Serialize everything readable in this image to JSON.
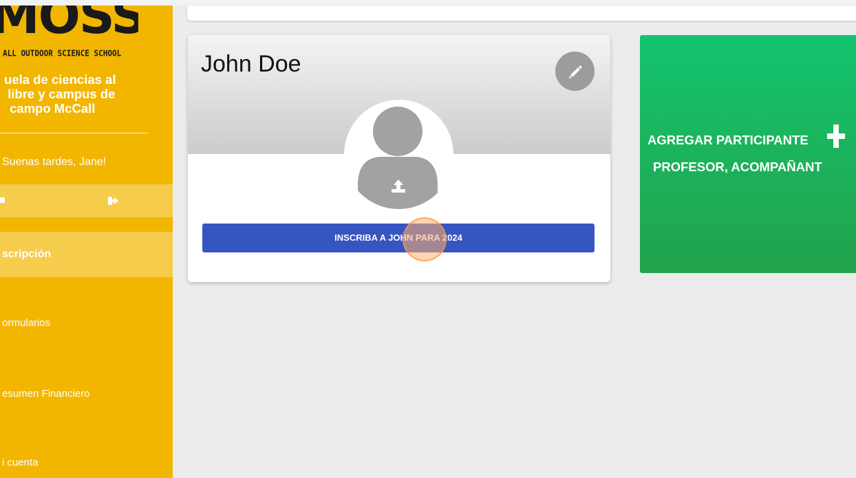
{
  "sidebar": {
    "logo_text": "MOSS",
    "logo_subtitle": "ALL OUTDOOR SCIENCE SCHOOL",
    "school_name": "uela de ciencias al libre y campus de campo McCall",
    "school_name_lines": [
      "uela de ciencias al",
      " libre y campus de",
      "campo McCall"
    ],
    "greeting": "Suenas tardes, Jane!",
    "nav_items": [
      {
        "label": "scripción",
        "active": true
      },
      {
        "label": "ormularios",
        "active": false
      },
      {
        "label": "esumen Financiero",
        "active": false
      },
      {
        "label": "i cuenta",
        "active": false
      }
    ]
  },
  "profile": {
    "name": "John Doe",
    "register_button": "INSCRIBA A JOHN PARA 2024"
  },
  "add_card": {
    "line1": "AGREGAR PARTICIPANTE",
    "line2": "PROFESOR, ACOMPAÑANT"
  },
  "colors": {
    "sidebar_bg": "#f2b600",
    "register_button_bg": "#3755c1",
    "add_card_bg": "#1bb35c",
    "edit_button_bg": "#9c9c9c"
  },
  "icons": {
    "settings": "gear-icon",
    "logout": "sign-out-icon",
    "edit": "pencil-icon",
    "upload": "upload-icon",
    "add": "plus-icon"
  }
}
